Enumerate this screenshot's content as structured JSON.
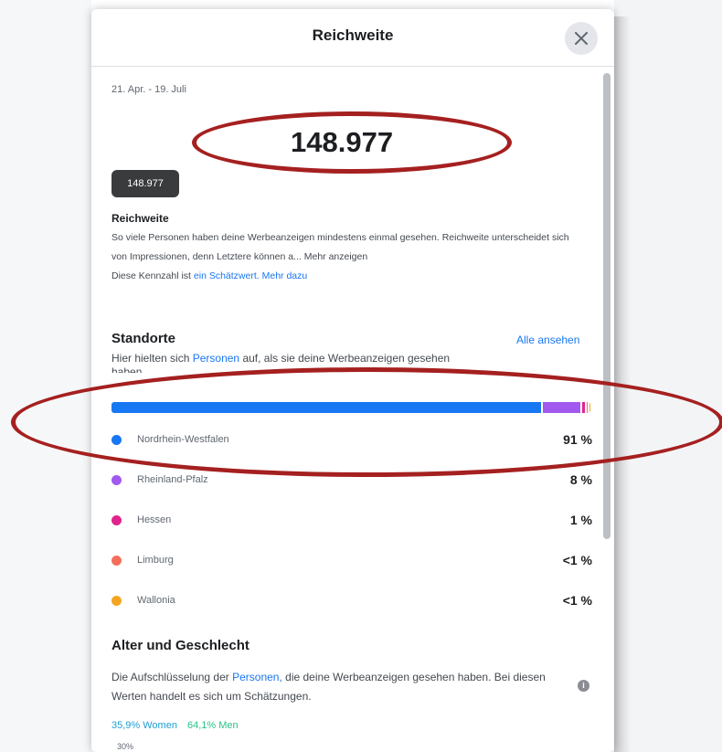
{
  "colors": {
    "accent": "#1877f2",
    "annotation": "#a52020",
    "women": "#1f9fd6",
    "men": "#27c48a"
  },
  "dialog": {
    "title": "Reichweite",
    "close_icon": "close-icon"
  },
  "summary": {
    "date_range": "21. Apr. - 19. Juli",
    "big_number": "148.977",
    "tooltip_value": "148.977",
    "metric_title": "Reichweite",
    "description_1": "So viele Personen haben deine Werbeanzeigen mindestens einmal gesehen. Reichweite unterscheidet sich von Impressionen, denn Letztere können a...",
    "show_more": "Mehr anzeigen",
    "estimate_prefix": "Diese Kennzahl ist",
    "estimate_link": "ein Schätzwert.",
    "learn_more": "Mehr dazu"
  },
  "locations": {
    "title": "Standorte",
    "see_all": "Alle ansehen",
    "subtitle_prefix": "Hier hielten sich",
    "subtitle_link": "Personen",
    "subtitle_suffix": "auf, als sie deine Werbeanzeigen gesehen",
    "subtitle_cut": "haben",
    "items": [
      {
        "name": "Nordrhein-Westfalen",
        "percent": "91 %",
        "share": 91,
        "color": "#1877f2"
      },
      {
        "name": "Rheinland-Pfalz",
        "percent": "8 %",
        "share": 8,
        "color": "#a259f0"
      },
      {
        "name": "Hessen",
        "percent": "1 %",
        "share": 0.6,
        "color": "#e0248e"
      },
      {
        "name": "Limburg",
        "percent": "<1 %",
        "share": 0.2,
        "color": "#f56e5c"
      },
      {
        "name": "Wallonia",
        "percent": "<1 %",
        "share": 0.2,
        "color": "#f4a623"
      }
    ]
  },
  "age_gender": {
    "title": "Alter und Geschlecht",
    "desc_prefix": "Die Aufschlüsselung der",
    "desc_link": "Personen,",
    "desc_suffix": "die deine Werbeanzeigen gesehen haben. Bei diesen Werten handelt es sich um Schätzungen.",
    "women": "35,9% Women",
    "men": "64,1% Men",
    "axis_top": "30%"
  }
}
